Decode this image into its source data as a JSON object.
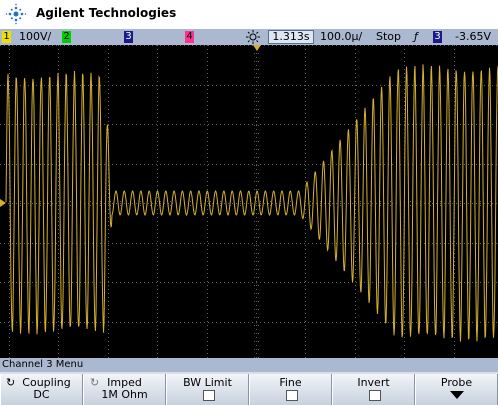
{
  "header": {
    "brand": "Agilent Technologies"
  },
  "statusbar": {
    "ch1_num": "1",
    "ch1_scale": "100V/",
    "ch2_num": "2",
    "ch3_num": "3",
    "ch4_num": "4",
    "timebase_icon": "sun-icon",
    "time_delay": "1.313s",
    "time_scale": "100.0µ/",
    "run_state": "Stop",
    "trigger_icon": "trigger-edge-icon",
    "trigger_source": "3",
    "trigger_level": "-3.65V"
  },
  "colors": {
    "ch1": "#f0e000",
    "ch2": "#00d000",
    "ch3": "#3030ff",
    "ch4": "#ff3090",
    "trace": "#d4b030",
    "statusbar": "#aab9d0"
  },
  "menu": {
    "title": "Channel 3  Menu",
    "softkeys": [
      {
        "line1": "Coupling",
        "line2": "DC",
        "icon": "rotate-knob-icon"
      },
      {
        "line1": "Imped",
        "line2": "1M Ohm",
        "icon": "rotate-knob-icon"
      },
      {
        "line1": "BW Limit",
        "checked": false
      },
      {
        "line1": "Fine",
        "checked": false
      },
      {
        "line1": "Invert",
        "checked": false
      },
      {
        "line1": "Probe",
        "icon": "arrow-down-icon"
      }
    ]
  }
}
